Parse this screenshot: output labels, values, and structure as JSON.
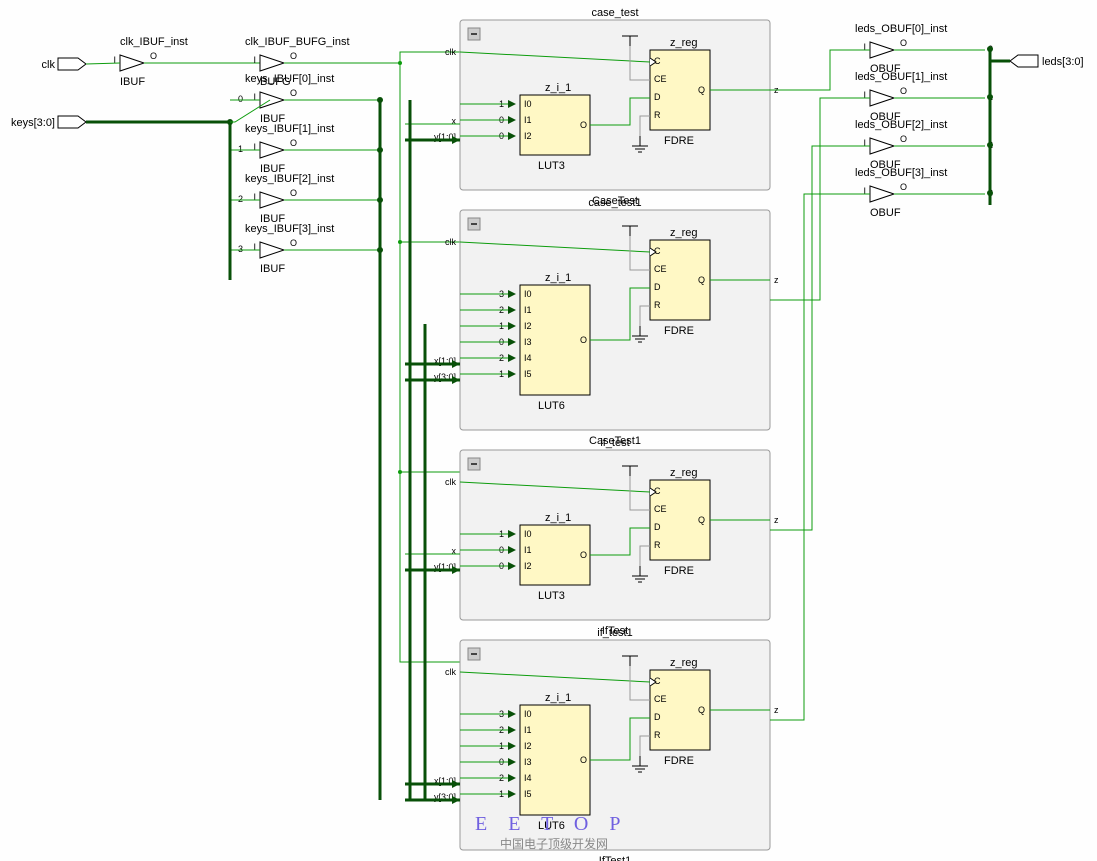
{
  "inputs": {
    "clk": "clk",
    "keys": "keys[3:0]"
  },
  "outputs": {
    "leds": "leds[3:0]"
  },
  "ibufs": {
    "clk_ibuf": {
      "inst": "clk_IBUF_inst",
      "type": "IBUF",
      "i": "I",
      "o": "O"
    },
    "clk_bufg": {
      "inst": "clk_IBUF_BUFG_inst",
      "type": "BUFG",
      "i": "I",
      "o": "O"
    },
    "k0": {
      "inst": "keys_IBUF[0]_inst",
      "type": "IBUF",
      "i": "I",
      "o": "O"
    },
    "k1": {
      "inst": "keys_IBUF[1]_inst",
      "type": "IBUF",
      "i": "I",
      "o": "O"
    },
    "k2": {
      "inst": "keys_IBUF[2]_inst",
      "type": "IBUF",
      "i": "I",
      "o": "O"
    },
    "k3": {
      "inst": "keys_IBUF[3]_inst",
      "type": "IBUF",
      "i": "I",
      "o": "O"
    }
  },
  "obufs": {
    "l0": {
      "inst": "leds_OBUF[0]_inst",
      "type": "OBUF",
      "i": "I",
      "o": "O"
    },
    "l1": {
      "inst": "leds_OBUF[1]_inst",
      "type": "OBUF",
      "i": "I",
      "o": "O"
    },
    "l2": {
      "inst": "leds_OBUF[2]_inst",
      "type": "OBUF",
      "i": "I",
      "o": "O"
    },
    "l3": {
      "inst": "leds_OBUF[3]_inst",
      "type": "OBUF",
      "i": "I",
      "o": "O"
    }
  },
  "blocks": {
    "case_test": {
      "title": "case_test",
      "subtitle": "CaseTest",
      "lut": "z_i_1",
      "luttype": "LUT3",
      "lutpins": [
        "I0",
        "I1",
        "I2"
      ],
      "lutidx": [
        "1",
        "0",
        "0"
      ],
      "reg": "z_reg",
      "regtype": "FDRE",
      "regpins": [
        "C",
        "CE",
        "D",
        "R",
        "Q"
      ],
      "clk": "clk",
      "in": [
        "x",
        "y[1:0]"
      ],
      "out": "z"
    },
    "case_test1": {
      "title": "case_test1",
      "subtitle": "CaseTest1",
      "lut": "z_i_1",
      "luttype": "LUT6",
      "lutpins": [
        "I0",
        "I1",
        "I2",
        "I3",
        "I4",
        "I5"
      ],
      "lutidx": [
        "3",
        "2",
        "1",
        "0",
        "2",
        "1"
      ],
      "reg": "z_reg",
      "regtype": "FDRE",
      "regpins": [
        "C",
        "CE",
        "D",
        "R",
        "Q"
      ],
      "clk": "clk",
      "in": [
        "x[1:0]",
        "y[3:0]"
      ],
      "out": "z"
    },
    "if_test": {
      "title": "if_test",
      "subtitle": "IfTest",
      "lut": "z_i_1",
      "luttype": "LUT3",
      "lutpins": [
        "I0",
        "I1",
        "I2"
      ],
      "lutidx": [
        "1",
        "0",
        "0"
      ],
      "reg": "z_reg",
      "regtype": "FDRE",
      "regpins": [
        "C",
        "CE",
        "D",
        "R",
        "Q"
      ],
      "clk": "clk",
      "in": [
        "x",
        "y[1:0]"
      ],
      "out": "z"
    },
    "if_test1": {
      "title": "if_test1",
      "subtitle": "IfTest1",
      "lut": "z_i_1",
      "luttype": "LUT6",
      "lutpins": [
        "I0",
        "I1",
        "I2",
        "I3",
        "I4",
        "I5"
      ],
      "lutidx": [
        "3",
        "2",
        "1",
        "0",
        "2",
        "1"
      ],
      "reg": "z_reg",
      "regtype": "FDRE",
      "regpins": [
        "C",
        "CE",
        "D",
        "R",
        "Q"
      ],
      "clk": "clk",
      "in": [
        "x[1:0]",
        "y[3:0]"
      ],
      "out": "z"
    }
  },
  "extra_labels": {
    "o_pin": "O",
    "bus10": "1:0",
    "idx0": "0",
    "idx1": "1",
    "idx2": "2",
    "idx3": "3"
  },
  "watermark": {
    "main": "E E T O P",
    "sub": "中国电子顶级开发网"
  }
}
